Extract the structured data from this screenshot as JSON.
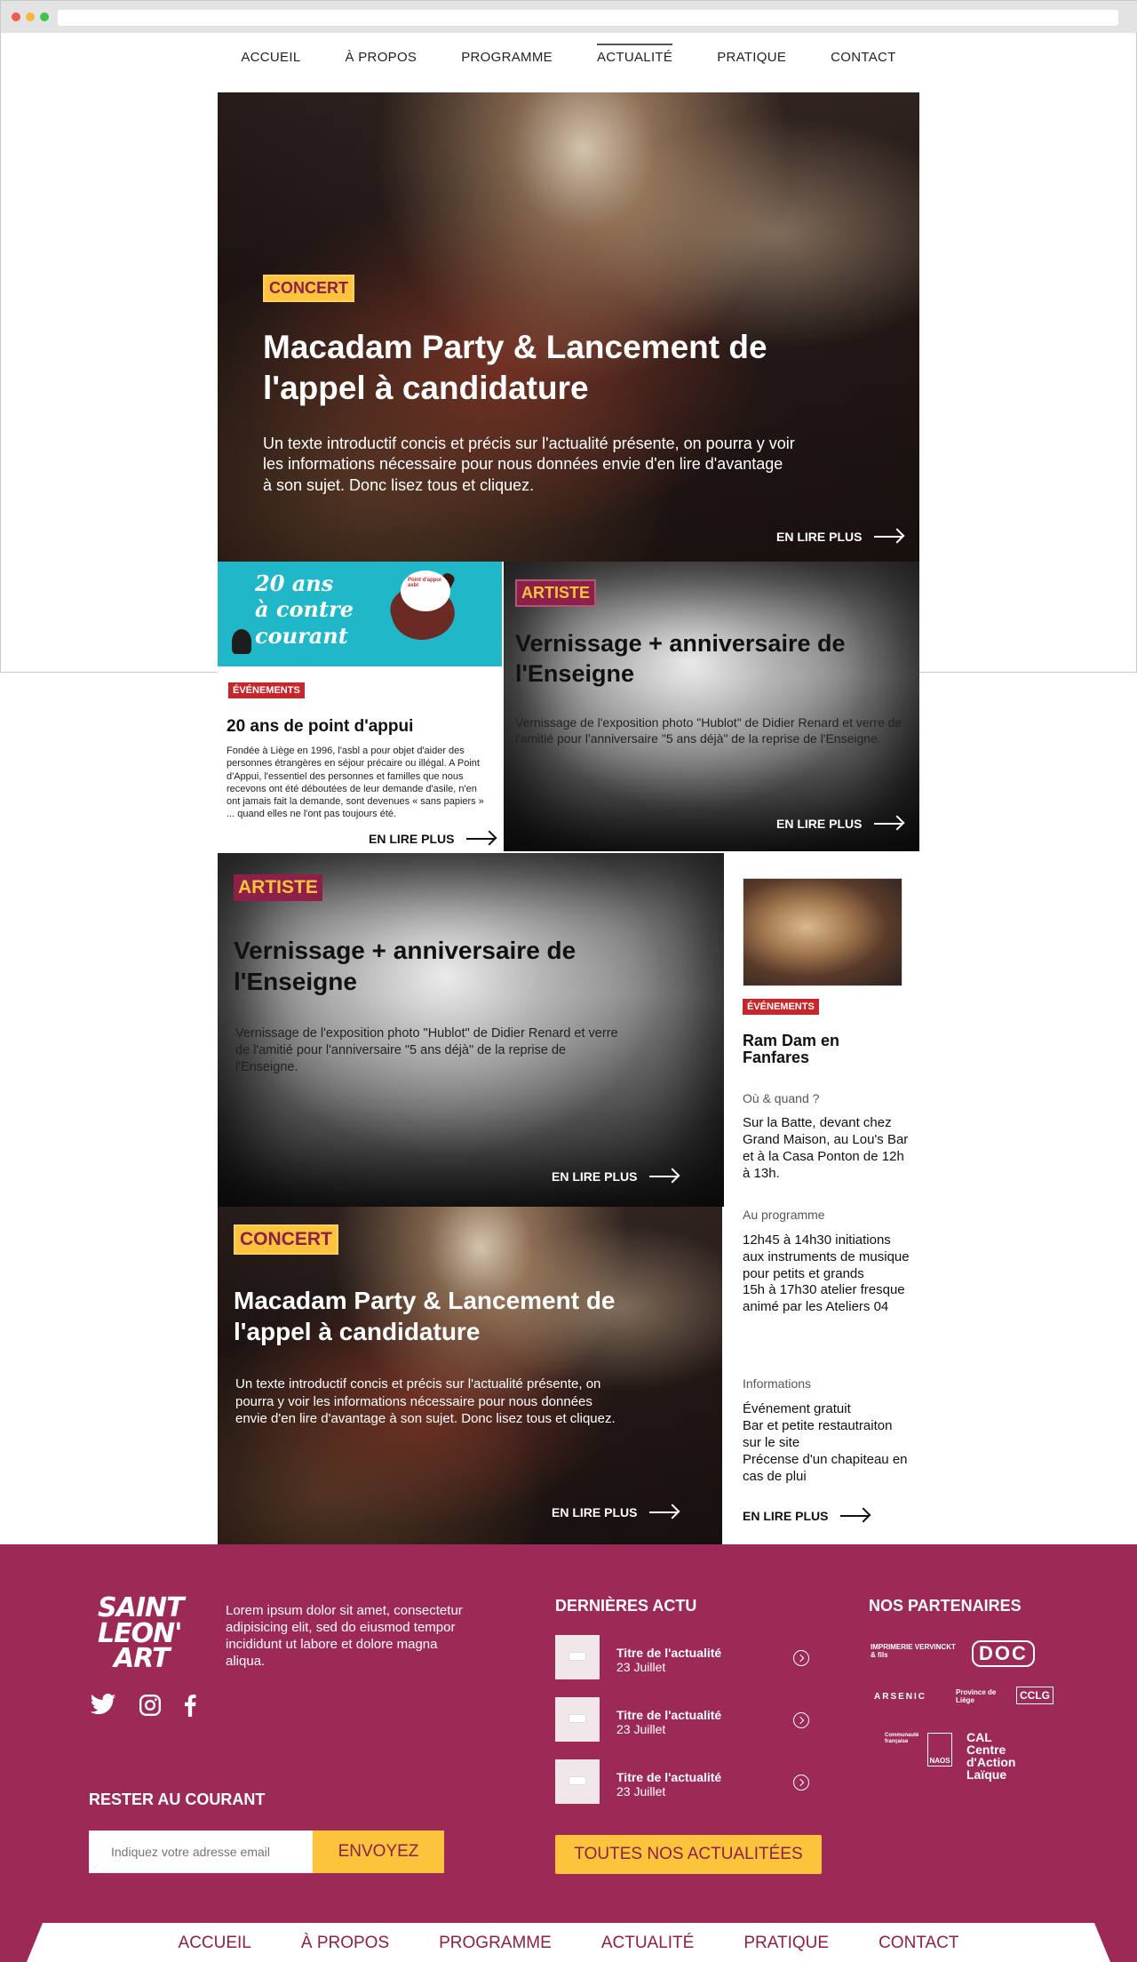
{
  "nav": {
    "items": [
      "ACCUEIL",
      "À PROPOS",
      "PROGRAMME",
      "ACTUALITÉ",
      "PRATIQUE",
      "CONTACT"
    ],
    "active": "ACTUALITÉ"
  },
  "hero": {
    "tag": "CONCERT",
    "title": "Macadam Party & Lancement de l'appel à candidature",
    "text": "Un texte introductif concis et précis sur l'actualité présente, on pourra y voir les informations nécessaire pour nous données envie d'en lire d'avantage à son sujet. Donc lisez tous et cliquez.",
    "more": "EN LIRE PLUS"
  },
  "card_ans": {
    "banner_line1": "20 ans",
    "banner_line2": "à contre",
    "banner_line3": "courant",
    "bubble": "Point d'appui asbl",
    "tag": "ÉVÉNEMENTS",
    "title": "20 ans de point d'appui",
    "text": "Fondée à Liège en 1996, l'asbl a pour objet d'aider des personnes étrangères en séjour précaire ou illégal. A Point d'Appui, l'essentiel des personnes et familles que nous recevons ont été déboutées de leur demande d'asile, n'en ont jamais fait la demande, sont devenues « sans papiers » ... quand elles ne l'ont pas toujours été.",
    "more": "EN LIRE PLUS"
  },
  "card_vern_small": {
    "tag": "ARTISTE",
    "title": "Vernissage + anniversaire de l'Enseigne",
    "text": "Vernissage de l'exposition photo \"Hublot\" de Didier Renard et verre de l'amitié pour l'anniversaire \"5 ans déjà\" de la reprise de l'Enseigne.",
    "more": "EN LIRE PLUS"
  },
  "card_vern_big": {
    "tag": "ARTISTE",
    "title": "Vernissage + anniversaire de l'Enseigne",
    "text": "Vernissage de l'exposition photo \"Hublot\" de Didier Renard et verre de l'amitié pour l'anniversaire \"5 ans déjà\" de la reprise de l'Enseigne.",
    "more": "EN LIRE PLUS"
  },
  "card_concert_big": {
    "tag": "CONCERT",
    "title": "Macadam Party & Lancement de l'appel à candidature",
    "text": "Un texte introductif concis et précis sur l'actualité présente, on pourra y voir les informations nécessaire pour nous données envie d'en lire d'avantage à son sujet. Donc lisez tous et cliquez.",
    "more": "EN LIRE PLUS"
  },
  "sidebar_event": {
    "tag": "ÉVÉNEMENTS",
    "title": "Ram Dam en Fanfares",
    "where_label": "Où & quand ?",
    "where_text": "Sur la Batte, devant chez Grand Maison, au Lou's Bar et à la Casa Ponton de 12h à 13h.",
    "program_label": "Au programme",
    "program_text_1": "12h45 à 14h30 initiations aux instruments de musique pour petits et grands",
    "program_text_2": "15h à 17h30 atelier fresque animé par les Ateliers 04",
    "info_label": "Informations",
    "info_text_1": "Événement gratuit",
    "info_text_2": "Bar et petite restautraiton sur le site",
    "info_text_3": "Précense d'un chapiteau en cas de plui",
    "more": "EN LIRE PLUS"
  },
  "footer": {
    "logo_line1": "SAINT",
    "logo_line2": "LEON'",
    "logo_line3": "ART",
    "description": "Lorem ipsum dolor sit amet, consectetur adipisicing elit, sed do eiusmod tempor incididunt ut labore et dolore magna aliqua.",
    "social_icons": [
      "twitter-icon",
      "instagram-icon",
      "facebook-icon"
    ],
    "news_heading": "DERNIÈRES ACTU",
    "news": [
      {
        "title": "Titre de l'actualité",
        "date": "23 Juillet"
      },
      {
        "title": "Titre de l'actualité",
        "date": "23 Juillet"
      },
      {
        "title": "Titre de l'actualité",
        "date": "23 Juillet"
      }
    ],
    "all_news": "TOUTES NOS ACTUALITÉES",
    "partners_heading": "NOS PARTENAIRES",
    "partners": [
      "IMPRIMERIE VERVINCKT & fils",
      "DOC",
      "ARSENIC",
      "Province de Liège",
      "CCLG",
      "Communauté française",
      "NAOS",
      "CAL Centre d'Action Laïque"
    ],
    "newsletter_heading": "RESTER AU COURANT",
    "newsletter_placeholder": "Indiquez votre adresse email",
    "newsletter_button": "ENVOYEZ"
  },
  "bottom_nav": [
    "ACCUEIL",
    "À PROPOS",
    "PROGRAMME",
    "ACTUALITÉ",
    "PRATIQUE",
    "CONTACT"
  ],
  "colors": {
    "brand_purple": "#9c2956",
    "accent_yellow": "#fcc33c",
    "tag_red": "#c7262b",
    "teal": "#20b7c9"
  }
}
